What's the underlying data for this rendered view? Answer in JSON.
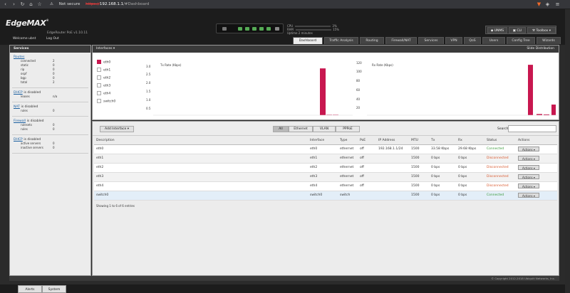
{
  "browser": {
    "security": "Not secure",
    "url_scheme": "https://",
    "url_host": "192.168.1.1",
    "url_path": "/#Dashboard"
  },
  "header": {
    "brand": "EdgeMAX",
    "model": "EdgeRouter PoE v1.10.11",
    "stats": {
      "cpu_label": "CPU",
      "cpu_value": "3%",
      "ram_label": "RAM",
      "ram_value": "15%",
      "uptime_label": "Uptime",
      "uptime_value": "2 minutes"
    },
    "buttons": {
      "unms": "UNMS",
      "cli": "CLI",
      "toolbox": "Toolbox"
    }
  },
  "welcome": {
    "text": "Welcome ubnt",
    "logout": "Log Out"
  },
  "tabs": [
    "Dashboard",
    "Traffic Analysis",
    "Routing",
    "Firewall/NAT",
    "Services",
    "VPN",
    "QoS",
    "Users",
    "Config Tree",
    "Wizards"
  ],
  "sidebar": {
    "title": "Services",
    "routes": {
      "link": "Routes",
      "rows": [
        {
          "k": "connected",
          "v": "2"
        },
        {
          "k": "static",
          "v": "0"
        },
        {
          "k": "rip",
          "v": "0"
        },
        {
          "k": "ospf",
          "v": "0"
        },
        {
          "k": "bgp",
          "v": "0"
        },
        {
          "k": "total",
          "v": "2"
        }
      ]
    },
    "dhcp_top": {
      "link": "DHCP",
      "status": "is disabled",
      "rows": [
        {
          "k": "leases",
          "v": "n/a"
        }
      ]
    },
    "nat": {
      "link": "NAT",
      "status": "is disabled",
      "rows": [
        {
          "k": "rules",
          "v": "0"
        }
      ]
    },
    "firewall": {
      "link": "Firewall",
      "status": "is disabled",
      "rows": [
        {
          "k": "rulesets",
          "v": "0"
        },
        {
          "k": "rules",
          "v": "0"
        }
      ]
    },
    "dhcpv6": {
      "link": "DHCP",
      "status": "is disabled",
      "rows": [
        {
          "k": "active servers",
          "v": "0"
        },
        {
          "k": "inactive servers",
          "v": "0"
        }
      ]
    }
  },
  "interfaces": {
    "title": "Interfaces",
    "slide": "Slide Distribution",
    "items": [
      "eth0",
      "eth1",
      "eth2",
      "eth3",
      "eth4",
      "switch0"
    ],
    "tx_label": "Tx Rate (Kbps)",
    "rx_label": "Rx Rate (Kbps)",
    "tx_ticks": [
      "3.0",
      "2.5",
      "2.0",
      "1.5",
      "1.0",
      "0.5"
    ],
    "rx_ticks": [
      "120",
      "100",
      "80",
      "60",
      "40",
      "20"
    ]
  },
  "chart_data": [
    {
      "type": "bar",
      "ylabel": "Tx Rate (Kbps)",
      "ylim": [
        0,
        3.5
      ],
      "values": [
        3.2,
        0.03,
        0.03
      ],
      "color": "#c8174f"
    },
    {
      "type": "bar",
      "ylabel": "Rx Rate (Kbps)",
      "ylim": [
        0,
        130
      ],
      "values": [
        128,
        3,
        2,
        27
      ],
      "color": "#c8174f"
    }
  ],
  "table_area": {
    "add_btn": "Add Interface",
    "filters": [
      "All",
      "Ethernet",
      "VLAN",
      "PPPoE"
    ],
    "search_label": "Search",
    "columns": [
      "Description",
      "Interface",
      "Type",
      "PoE",
      "IP Address",
      "MTU",
      "Tx",
      "Rx",
      "Status",
      "Actions"
    ],
    "rows": [
      [
        "eth0",
        "eth0",
        "ethernet",
        "off",
        "192.168.1.1/24",
        "1500",
        "33.58 Kbps",
        "29.68 Kbps",
        "Connected",
        "Actions"
      ],
      [
        "eth1",
        "eth1",
        "ethernet",
        "off",
        "",
        "1500",
        "0 bps",
        "0 bps",
        "Disconnected",
        "Actions"
      ],
      [
        "eth2",
        "eth2",
        "ethernet",
        "off",
        "",
        "1500",
        "0 bps",
        "0 bps",
        "Disconnected",
        "Actions"
      ],
      [
        "eth3",
        "eth3",
        "ethernet",
        "off",
        "",
        "1500",
        "0 bps",
        "0 bps",
        "Disconnected",
        "Actions"
      ],
      [
        "eth4",
        "eth4",
        "ethernet",
        "off",
        "",
        "1500",
        "0 bps",
        "0 bps",
        "Disconnected",
        "Actions"
      ],
      [
        "switch0",
        "switch0",
        "switch",
        "",
        "",
        "1500",
        "0 bps",
        "0 bps",
        "Connected",
        "Actions"
      ]
    ],
    "showing": "Showing 1 to 6 of 6 entries"
  },
  "footer": {
    "copyright": "© Copyright 2012-2018 Ubiquiti Networks, Inc."
  },
  "bottom": {
    "alerts": "Alerts",
    "system": "System"
  }
}
